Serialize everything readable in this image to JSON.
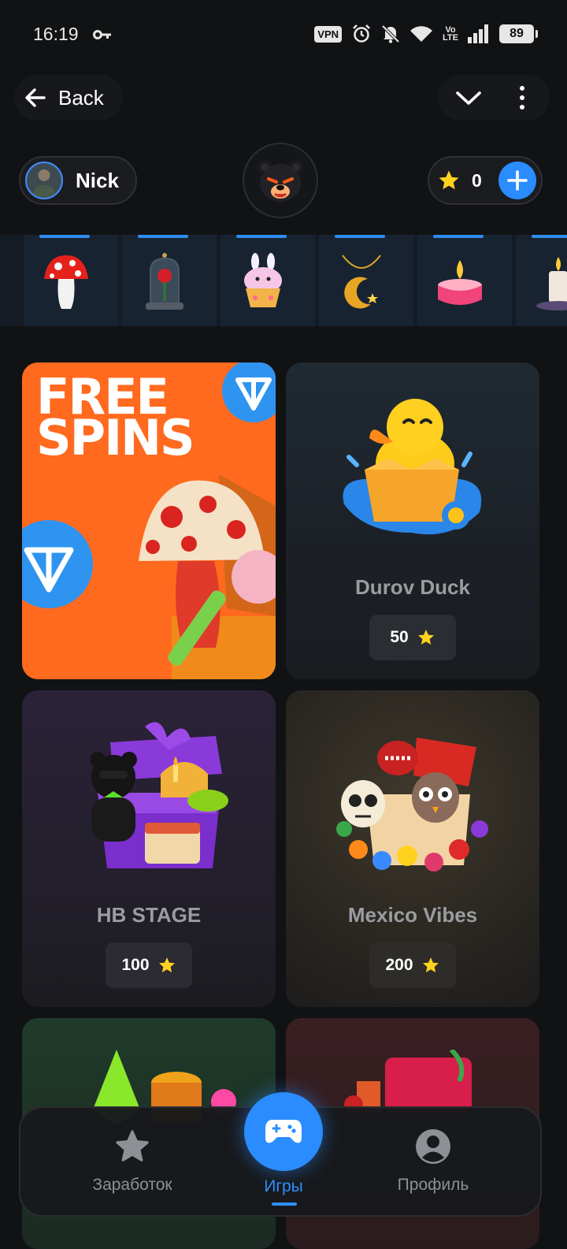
{
  "status_bar": {
    "time": "16:19",
    "vpn": "VPN",
    "volte_top": "Vo",
    "volte_bottom": "LTE",
    "battery": "89"
  },
  "top_nav": {
    "back_label": "Back"
  },
  "header": {
    "user_name": "Nick",
    "balance": "0"
  },
  "item_strip": {
    "items": [
      "mushroom-icon",
      "rose-bell-jar-icon",
      "bunny-cupcake-icon",
      "moon-pendant-icon",
      "candle-icon",
      "candle-icon"
    ]
  },
  "cards": [
    {
      "type": "promo",
      "line1": "FREE",
      "line2": "SPINS"
    },
    {
      "title": "Durov Duck",
      "price": "50",
      "image": "rubber-duck-box-icon"
    },
    {
      "title": "HB STAGE",
      "price": "100",
      "image": "birthday-gift-box-icon"
    },
    {
      "title": "Mexico Vibes",
      "price": "200",
      "image": "mexico-box-icon"
    }
  ],
  "bottom_nav": {
    "earn_label": "Заработок",
    "games_label": "Игры",
    "profile_label": "Профиль"
  },
  "colors": {
    "accent": "#2a8cff",
    "star": "#ffd21f",
    "background": "#111214",
    "promo": "#ff6a1f"
  }
}
